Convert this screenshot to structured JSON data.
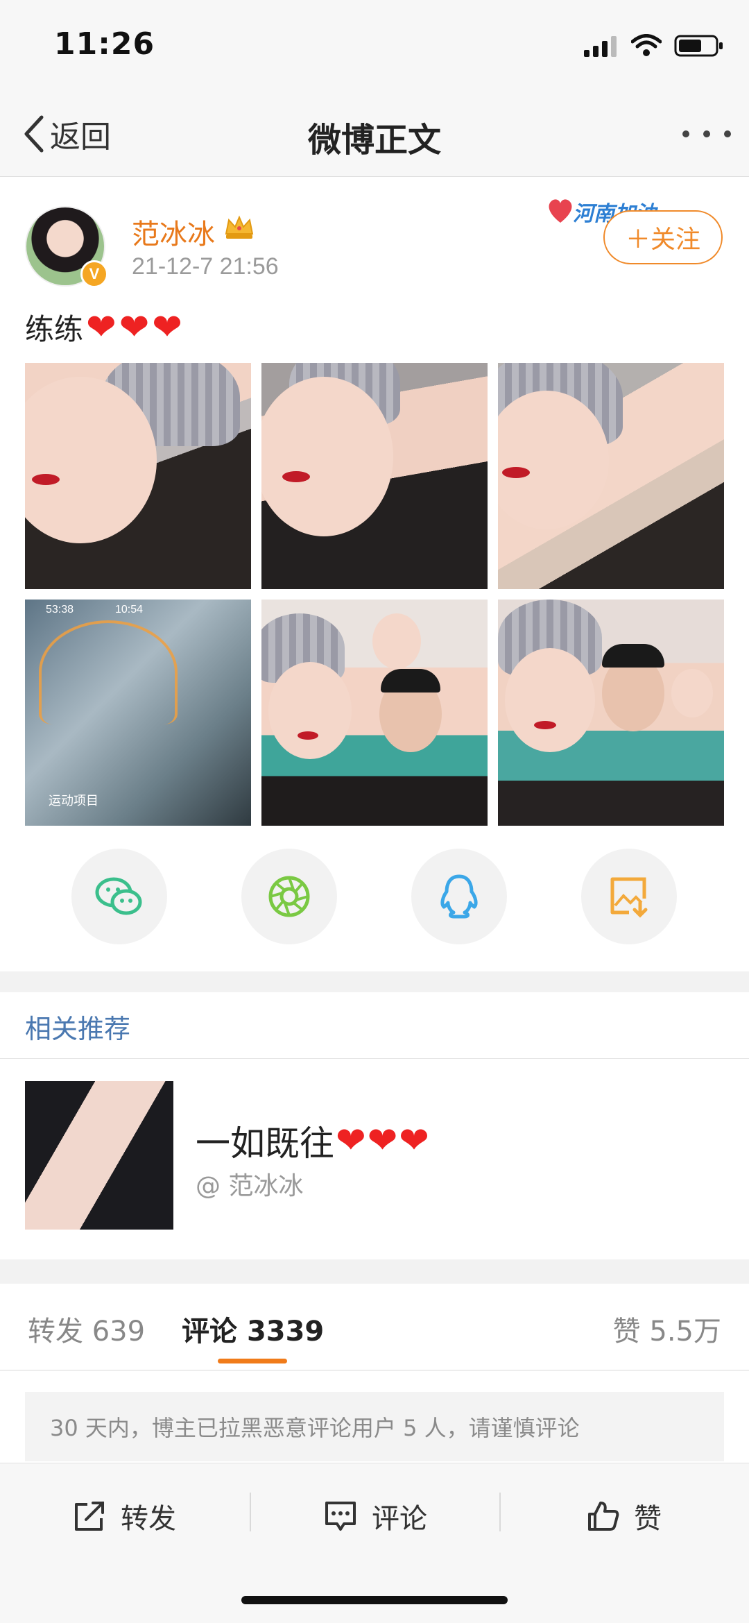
{
  "status_bar": {
    "time": "11:26"
  },
  "nav": {
    "back_label": "返回",
    "title": "微博正文"
  },
  "post": {
    "author": "范冰冰",
    "timestamp": "21-12-7 21:56",
    "verified_badge": "V",
    "event_tag": "河南加油",
    "follow_label": "＋关注",
    "text": "练练",
    "text_emoji": [
      "❤",
      "❤",
      "❤"
    ],
    "photo_count": 6,
    "photo4_times": [
      "53:38",
      "10:54"
    ],
    "photo4_label": "运动项目",
    "share_targets": [
      "wechat-icon",
      "moments-icon",
      "qq-icon",
      "save-image-icon"
    ]
  },
  "related": {
    "heading": "相关推荐",
    "item": {
      "title": "一如既往",
      "title_emoji": [
        "❤",
        "❤",
        "❤"
      ],
      "author": "@ 范冰冰"
    }
  },
  "tabs": [
    {
      "label": "转发",
      "count": "639"
    },
    {
      "label": "评论",
      "count": "3339"
    },
    {
      "label": "赞",
      "count": "5.5万"
    }
  ],
  "notice": "30 天内，博主已拉黑恶意评论用户 5 人，请谨慎评论",
  "bottom_actions": [
    {
      "label": "转发",
      "icon": "repost-icon"
    },
    {
      "label": "评论",
      "icon": "comment-icon"
    },
    {
      "label": "赞",
      "icon": "like-icon"
    }
  ],
  "colors": {
    "accent": "#f07b1a",
    "author_name": "#e8791b",
    "link_blue": "#4a78b0"
  }
}
